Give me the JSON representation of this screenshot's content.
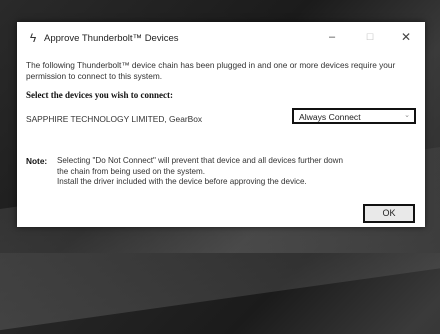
{
  "window": {
    "title": "Approve Thunderbolt™ Devices",
    "app_icon_glyph": "ϟ",
    "minimize_glyph": "–",
    "maximize_glyph": "☐",
    "close_glyph": "✕"
  },
  "description": "The following Thunderbolt™ device chain has been plugged in and one or more devices require your permission to connect to this system.",
  "heading": "Select the devices you wish to connect:",
  "device": {
    "name": "SAPPHIRE TECHNOLOGY LIMITED, GearBox",
    "selected_option": "Always Connect",
    "dropdown_glyph": "⌄"
  },
  "note": {
    "label": "Note:",
    "lines": [
      "Selecting \"Do Not Connect\" will prevent that device and all devices further down",
      "the chain from being used on the system.",
      "Install the driver included with the device before approving the device."
    ]
  },
  "ok_label": "OK",
  "colors": {
    "dialog_bg": "#ffffff",
    "focus_border": "#111111",
    "button_bg": "#e9e9e9"
  }
}
